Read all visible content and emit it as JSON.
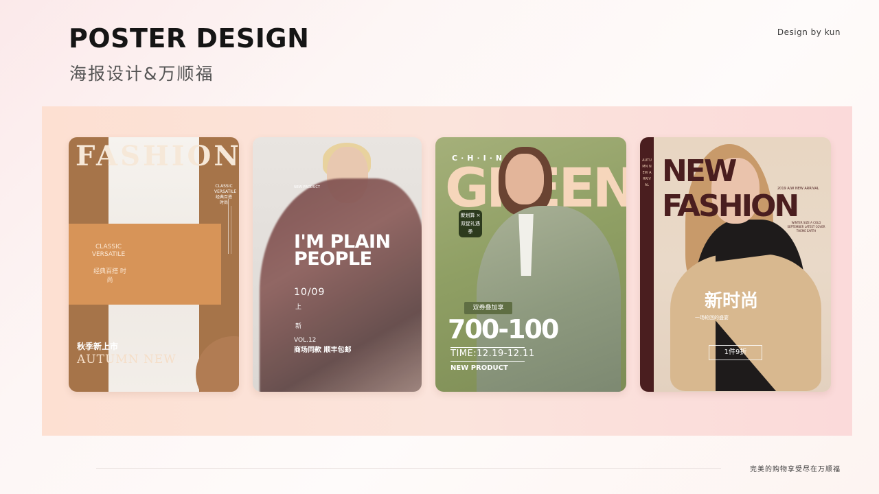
{
  "header": {
    "title": "POSTER DESIGN",
    "subtitle": "海报设计&万顺福",
    "credit": "Design by kun"
  },
  "posters": [
    {
      "headline": "FASHION",
      "tag_en": "CLASSIC VERSATILE",
      "tag_cn": "经典百搭 时尚",
      "small_right": "CLASSIC VERSATILE 经典百搭 时尚",
      "bottom_cn": "秋季新上市",
      "bottom_en": "AUTUMN NEW"
    },
    {
      "small_label": "NEW PRODUCT",
      "headline": "I'M PLAIN PEOPLE",
      "date": "10/09",
      "shang": "上",
      "xin": "新",
      "vol": "VOL.12",
      "tagline": "商场同款 顺丰包邮"
    },
    {
      "top_letters": "C·H·I·N",
      "headline": "GREEN",
      "badge": "聚划算 × 双促礼遇季",
      "sub_tag": "双券叠加享",
      "price": "700-100",
      "time": "TIME:12.19-12.11",
      "new_product": "NEW PRODUCT"
    },
    {
      "headline": "NEW FASHION",
      "arrival": "2019 A/W NEW ARRIVAL",
      "side_text": "AUTUMN NEW ARRIVAL",
      "desc": "WINTER SIZE A COLD SEPTEMBER LATEST COVER THEME EARTH",
      "big_cn": "新时尚",
      "small_cn": "一场轮回的盛宴",
      "button": "1件9折"
    }
  ],
  "footer": {
    "text": "完美的购物享受尽在万顺福"
  }
}
